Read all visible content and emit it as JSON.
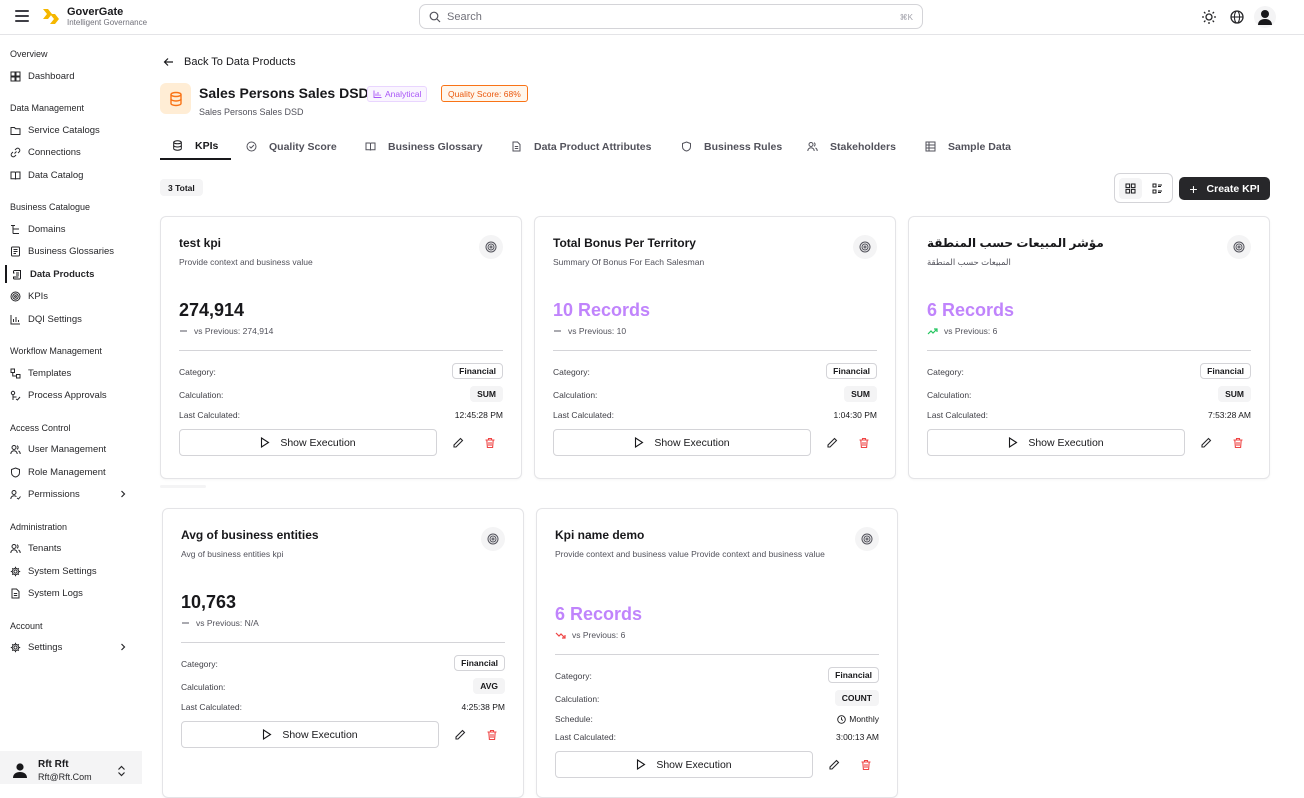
{
  "app": {
    "name": "GoverGate",
    "tagline": "Intelligent Governance"
  },
  "search": {
    "placeholder": "Search",
    "shortcut": "⌘K"
  },
  "sidebar": {
    "sections": [
      {
        "title": "Overview",
        "items": [
          {
            "label": "Dashboard",
            "icon": "dashboard-icon"
          }
        ]
      },
      {
        "title": "Data Management",
        "items": [
          {
            "label": "Service Catalogs",
            "icon": "folder-icon"
          },
          {
            "label": "Connections",
            "icon": "link-icon"
          },
          {
            "label": "Data Catalog",
            "icon": "book-icon"
          }
        ]
      },
      {
        "title": "Business Catalogue",
        "items": [
          {
            "label": "Domains",
            "icon": "domains-icon"
          },
          {
            "label": "Business Glossaries",
            "icon": "glossary-icon"
          },
          {
            "label": "Data Products",
            "icon": "scroll-icon",
            "active": true
          },
          {
            "label": "KPIs",
            "icon": "target-icon"
          },
          {
            "label": "DQI Settings",
            "icon": "bar-chart-icon"
          }
        ]
      },
      {
        "title": "Workflow Management",
        "items": [
          {
            "label": "Templates",
            "icon": "workflow-icon"
          },
          {
            "label": "Process Approvals",
            "icon": "approvals-icon"
          }
        ]
      },
      {
        "title": "Access Control",
        "items": [
          {
            "label": "User Management",
            "icon": "users-icon"
          },
          {
            "label": "Role Management",
            "icon": "shield-icon"
          },
          {
            "label": "Permissions",
            "icon": "user-key-icon",
            "expandable": true
          }
        ]
      },
      {
        "title": "Administration",
        "items": [
          {
            "label": "Tenants",
            "icon": "users-icon"
          },
          {
            "label": "System Settings",
            "icon": "gear-icon"
          },
          {
            "label": "System Logs",
            "icon": "file-icon"
          }
        ]
      },
      {
        "title": "Account",
        "items": [
          {
            "label": "Settings",
            "icon": "gear-icon",
            "expandable": true
          }
        ]
      }
    ],
    "user": {
      "name": "Rft Rft",
      "email": "Rft@Rft.Com"
    }
  },
  "page": {
    "back_label": "Back To Data Products",
    "title": "Sales Persons Sales DSD",
    "subtitle": "Sales Persons Sales DSD",
    "type_badge": "Analytical",
    "quality_badge": "Quality Score: 68%",
    "tabs": [
      {
        "label": "KPIs",
        "icon": "database-icon",
        "active": true
      },
      {
        "label": "Quality Score",
        "icon": "check-circle-icon"
      },
      {
        "label": "Business Glossary",
        "icon": "book-icon"
      },
      {
        "label": "Data Product Attributes",
        "icon": "file-icon"
      },
      {
        "label": "Business Rules",
        "icon": "shield-icon"
      },
      {
        "label": "Stakeholders",
        "icon": "users-icon"
      },
      {
        "label": "Sample Data",
        "icon": "table-icon"
      }
    ],
    "total_label": "3 Total",
    "create_label": "Create KPI"
  },
  "labels": {
    "category": "Category:",
    "calculation": "Calculation:",
    "schedule": "Schedule:",
    "last_calculated": "Last Calculated:",
    "show_execution": "Show Execution"
  },
  "kpis": [
    {
      "title": "test kpi",
      "description": "Provide context and business value",
      "value": "274,914",
      "value_style": "plain",
      "trend": "flat",
      "previous": "vs Previous: 274,914",
      "category": "Financial",
      "calculation": "SUM",
      "last_calculated": "12:45:28 PM"
    },
    {
      "title": "Total Bonus Per Territory",
      "description": "Summary Of Bonus For Each Salesman",
      "value": "10 Records",
      "value_style": "records",
      "trend": "flat",
      "previous": "vs Previous: 10",
      "category": "Financial",
      "calculation": "SUM",
      "last_calculated": "1:04:30 PM"
    },
    {
      "title": "مؤشر المبيعات حسب المنطقة",
      "description": "المبيعات حسب المنطقة",
      "value": "6 Records",
      "value_style": "records",
      "trend": "up",
      "previous": "vs Previous: 6",
      "category": "Financial",
      "calculation": "SUM",
      "last_calculated": "7:53:28 AM"
    },
    {
      "title": "Avg of business entities",
      "description": "Avg of business entities kpi",
      "value": "10,763",
      "value_style": "plain",
      "trend": "flat",
      "previous": "vs Previous: N/A",
      "category": "Financial",
      "calculation": "AVG",
      "last_calculated": "4:25:38 PM"
    },
    {
      "title": "Kpi name demo",
      "description": "Provide context and business value Provide context and business value",
      "value": "6 Records",
      "value_style": "records",
      "trend": "down",
      "previous": "vs Previous: 6",
      "category": "Financial",
      "calculation": "COUNT",
      "schedule": "Monthly",
      "last_calculated": "3:00:13 AM"
    }
  ],
  "colors": {
    "accent": "#18181b",
    "records": "#c084fc",
    "quality": "#ea580c",
    "analytical": "#a855f7",
    "delete": "#ef4444",
    "trend_up": "#22c55e",
    "trend_down": "#ef4444"
  }
}
